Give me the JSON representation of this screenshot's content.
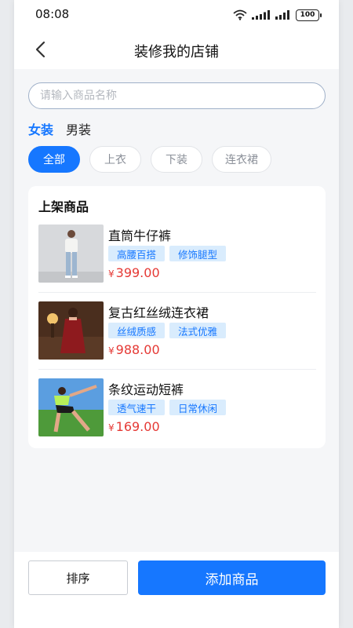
{
  "status_bar": {
    "time": "08:08",
    "battery": "100",
    "icons": [
      "wifi-icon",
      "signal-icon",
      "signal-icon",
      "battery-icon"
    ]
  },
  "header": {
    "title": "装修我的店铺",
    "back_icon": "chevron-left-icon"
  },
  "search": {
    "placeholder": "请输入商品名称",
    "value": ""
  },
  "gender_tabs": [
    {
      "label": "女装",
      "active": true
    },
    {
      "label": "男装",
      "active": false
    }
  ],
  "categories": [
    {
      "label": "全部",
      "active": true
    },
    {
      "label": "上衣",
      "active": false
    },
    {
      "label": "下装",
      "active": false
    },
    {
      "label": "连衣裙",
      "active": false
    }
  ],
  "products_section": {
    "title": "上架商品",
    "items": [
      {
        "name": "直筒牛仔裤",
        "tags": [
          "高腰百搭",
          "修饰腿型"
        ],
        "currency": "¥",
        "price": "399.00"
      },
      {
        "name": "复古红丝绒连衣裙",
        "tags": [
          "丝绒质感",
          "法式优雅"
        ],
        "currency": "¥",
        "price": "988.00"
      },
      {
        "name": "条纹运动短裤",
        "tags": [
          "透气速干",
          "日常休闲"
        ],
        "currency": "¥",
        "price": "169.00"
      }
    ]
  },
  "bottom_bar": {
    "sort_label": "排序",
    "add_label": "添加商品"
  },
  "colors": {
    "accent": "#1677ff",
    "price": "#e53935",
    "tag_bg": "#d9ecfd",
    "background": "#f5f6f8"
  }
}
